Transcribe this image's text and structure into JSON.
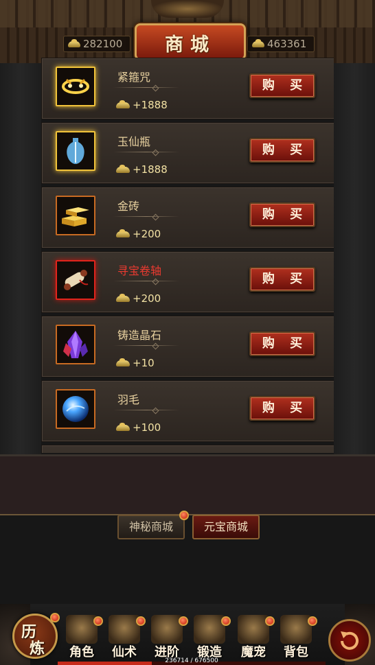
{
  "header": {
    "title": "商城",
    "currency_left": "282100",
    "currency_right": "463361"
  },
  "items": [
    {
      "name": "紧箍咒",
      "price": "1888",
      "buy_label": "购 买",
      "icon": "golden-circlet-icon",
      "frame": "gold"
    },
    {
      "name": "玉仙瓶",
      "price": "1888",
      "buy_label": "购 买",
      "icon": "jade-vase-icon",
      "frame": "gold"
    },
    {
      "name": "金砖",
      "price": "200",
      "buy_label": "购 买",
      "icon": "gold-bricks-icon",
      "frame": "orange"
    },
    {
      "name": "寻宝卷轴",
      "price": "200",
      "buy_label": "购 买",
      "icon": "treasure-scroll-icon",
      "frame": "red"
    },
    {
      "name": "铸造晶石",
      "price": "10",
      "buy_label": "购 买",
      "icon": "forging-crystal-icon",
      "frame": "orange"
    },
    {
      "name": "羽毛",
      "price": "100",
      "buy_label": "购 买",
      "icon": "blue-orb-icon",
      "frame": "orange"
    }
  ],
  "tabs": {
    "mystery": "神秘商城",
    "yuanbao": "元宝商城"
  },
  "bottom_nav": {
    "lilian": "历炼",
    "lilian_chars": [
      "历",
      "炼"
    ],
    "items": [
      {
        "label": "角色",
        "icon": "armor-icon"
      },
      {
        "label": "仙术",
        "icon": "spellbook-icon"
      },
      {
        "label": "进阶",
        "icon": "scroll-icon"
      },
      {
        "label": "锻造",
        "icon": "anvil-icon"
      },
      {
        "label": "魔宠",
        "icon": "pet-icon"
      },
      {
        "label": "背包",
        "icon": "bag-icon"
      }
    ],
    "exp_text": "236714 / 676500",
    "exp_fraction": 0.35
  },
  "colors": {
    "gold_text": "#e9d2a0",
    "red_name": "#ec3a30",
    "buy_button": "#b0301e"
  }
}
